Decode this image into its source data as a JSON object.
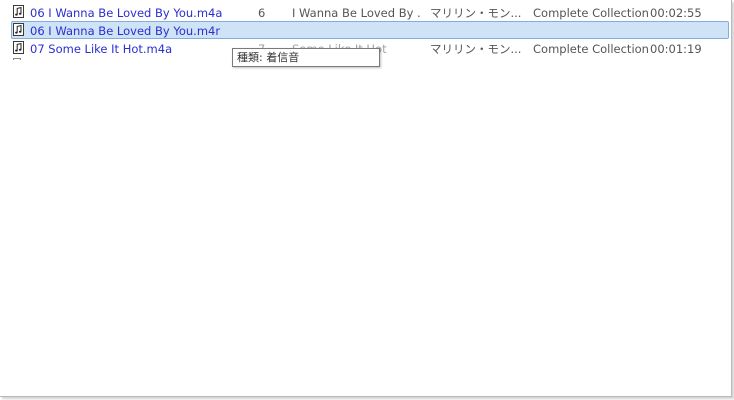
{
  "rows": [
    {
      "name": "06 I Wanna Be Loved By You.m4a",
      "track": "6",
      "title": "I Wanna Be Loved By ...",
      "artist": "マリリン・モン...",
      "album": "Complete Collection",
      "duration": "00:02:55",
      "icon": "music-file-icon"
    },
    {
      "name": "06 I Wanna Be Loved By You.m4r",
      "track": "",
      "title": "",
      "artist": "",
      "album": "",
      "duration": "",
      "icon": "music-file-icon",
      "selected": true
    },
    {
      "name": "07 Some Like It Hot.m4a",
      "track": "7",
      "title": "Some Like It Hot",
      "artist": "マリリン・モン...",
      "album": "Complete Collection",
      "duration": "00:01:19",
      "icon": "music-file-icon"
    }
  ],
  "tooltip": {
    "text": "種類: 着信音"
  },
  "colors": {
    "link_text": "#2a2fd0",
    "selection_fill": "#cfe3f7",
    "selection_border": "#84acdd"
  }
}
